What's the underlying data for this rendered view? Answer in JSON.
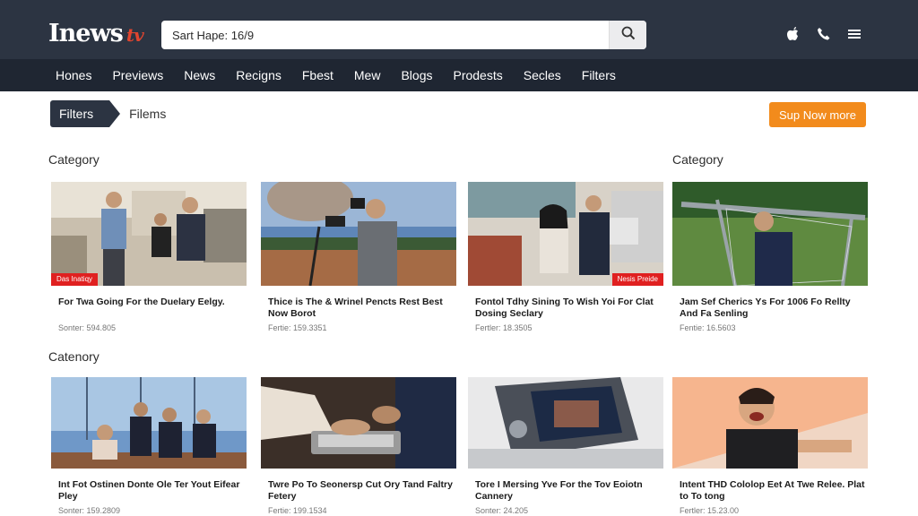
{
  "brand": {
    "name": "Inews",
    "accent": "tv"
  },
  "search": {
    "value": "Sart Hape: 16/9"
  },
  "nav": [
    "Hones",
    "Previews",
    "News",
    "Recigns",
    "Fbest",
    "Mew",
    "Blogs",
    "Prodests",
    "Secles",
    "Filters"
  ],
  "breadcrumb": {
    "tag": "Filters",
    "current": "Filems"
  },
  "cta": {
    "label": "Sup Now more"
  },
  "sections": [
    "Category",
    "Category",
    "Catenory"
  ],
  "row1": [
    {
      "badge": "Das Inatiqy",
      "title": "For Twa Going For the Duelary Eelgy.",
      "meta": "Sonter: 594.805"
    },
    {
      "badge": "",
      "title": "Thice is The & Wrinel Pencts Rest Best Now Borot",
      "meta": "Fertie: 159.3351"
    },
    {
      "badge": "Nesis Preide",
      "title": "Fontol Tdhy Sining To Wish Yoi For Clat Dosing Seclary",
      "meta": "Fertler: 18.3505"
    },
    {
      "badge": "",
      "title": "Jam Sef Cherics Ys For 1006 Fo Rellty And Fa Senling",
      "meta": "Fentie: 16.5603"
    }
  ],
  "row2": [
    {
      "badge": "",
      "title": "Int Fot Ostinen Donte Ole Ter Yout Eifear Pley",
      "meta": "Sonter: 159.2809"
    },
    {
      "badge": "",
      "title": "Twre Po To Seonersp Cut Ory Tand Faltry Fetery",
      "meta": "Fertie: 199.1534"
    },
    {
      "badge": "",
      "title": "Tore I Mersing Yve For the Tov Eoiotn Cannery",
      "meta": "Sonter: 24.205"
    },
    {
      "badge": "",
      "title": "Intent THD Cololop Eet At Twe Relee. Plat to To tong",
      "meta": "Fertler: 15.23.00"
    }
  ],
  "colors": {
    "topbar": "#2c3442",
    "navbar": "#1f2632",
    "cta": "#f28b1c",
    "badge": "#e02020"
  }
}
